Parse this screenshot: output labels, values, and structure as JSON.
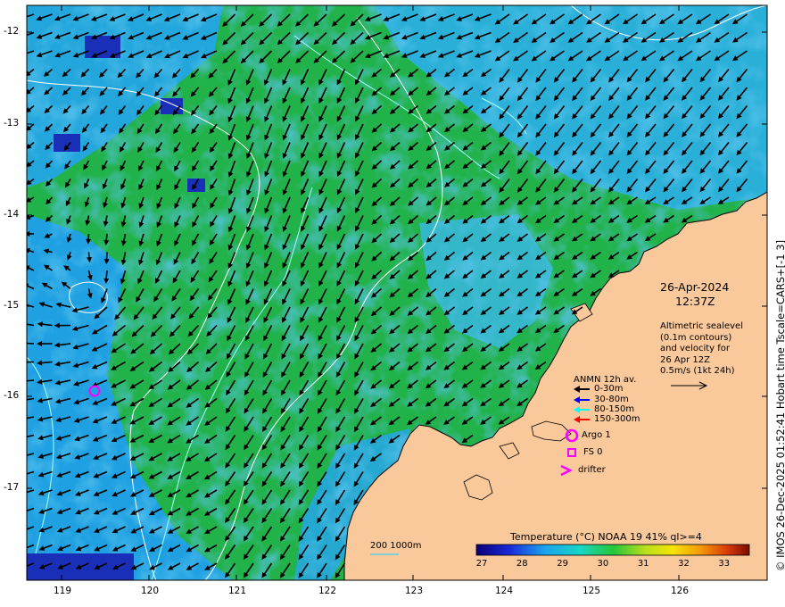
{
  "map": {
    "lon_ticks": [
      "119",
      "120",
      "121",
      "122",
      "123",
      "124",
      "125",
      "126"
    ],
    "lat_ticks": [
      "-12",
      "-13",
      "-14",
      "-15",
      "-16",
      "-17"
    ]
  },
  "annotations": {
    "date": "26-Apr-2024",
    "time": "12:37Z",
    "alti_lines": [
      "Altimetric sealevel",
      "(0.1m contours)",
      "and velocity for",
      "26 Apr 12Z",
      "0.5m/s (1kt 24h)"
    ]
  },
  "legend": {
    "title": "ANMN 12h av.",
    "rows": [
      {
        "label": "0-30m",
        "color": "#000000"
      },
      {
        "label": "30-80m",
        "color": "#0000ff"
      },
      {
        "label": "80-150m",
        "color": "#00ffff"
      },
      {
        "label": "150-300m",
        "color": "#ff0000"
      }
    ],
    "argo_label": "Argo 1",
    "fs_label": "FS 0",
    "drifter_label": "drifter",
    "symbol_color": "#ff00ff"
  },
  "colorbar": {
    "title": "Temperature (°C) NOAA 19 41% ql>=4",
    "ticks": [
      "27",
      "28",
      "29",
      "30",
      "31",
      "32",
      "33"
    ]
  },
  "scale": {
    "label": "200  1000m"
  },
  "credit": "© IMOS 26-Dec-2025 01:52:41 Hobart time Tscale=CARS+[-1 3]",
  "colors": {
    "land": "#f9c89b",
    "ocean_mid": "#22b24a",
    "ocean_cool": "#22a0e0",
    "contour": "#bfffff"
  }
}
